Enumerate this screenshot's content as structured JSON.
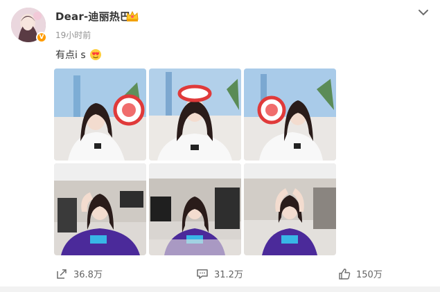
{
  "post": {
    "username": "Dear-迪丽热巴",
    "timestamp": "19小时前",
    "text": "有点i s",
    "verified_badge": "V",
    "icons": {
      "crown": "crown-emoji-icon",
      "emoji": "heart-eyes-emoji-icon",
      "chevron": "chevron-down-icon",
      "verified": "verified-badge-icon"
    }
  },
  "photos": [
    {
      "label": "photo-1"
    },
    {
      "label": "photo-2"
    },
    {
      "label": "photo-3"
    },
    {
      "label": "photo-4"
    },
    {
      "label": "photo-5"
    },
    {
      "label": "photo-6"
    }
  ],
  "actions": {
    "forward_count": "36.8万",
    "comment_count": "31.2万",
    "like_count": "150万"
  },
  "colors": {
    "verified": "#ff9b00",
    "text": "#333333",
    "meta": "#939393",
    "shirt_white": "#f7f7f7",
    "shirt_purple": "#4b2a9a",
    "sky": "#9fc6e8"
  }
}
